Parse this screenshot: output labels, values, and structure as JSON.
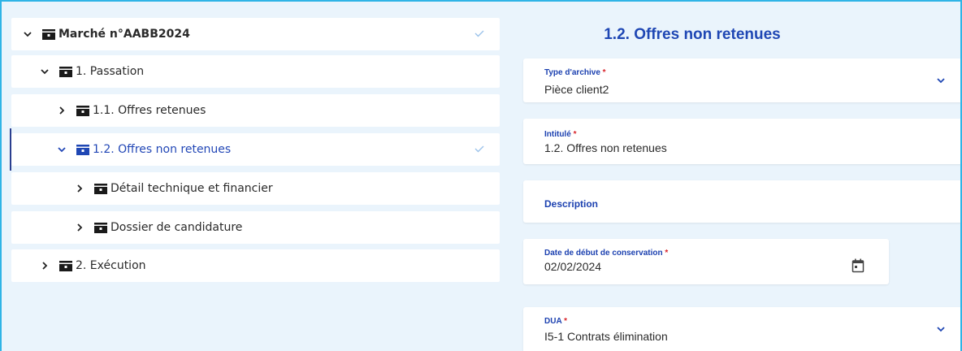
{
  "tree": {
    "items": [
      {
        "label": "Marché n°AABB2024",
        "level": "root",
        "expanded": true,
        "checked": true
      },
      {
        "label": "1. Passation",
        "level": 1,
        "expanded": true,
        "checked": false
      },
      {
        "label": "1.1. Offres retenues",
        "level": 2,
        "expanded": false,
        "checked": false
      },
      {
        "label": "1.2. Offres non retenues",
        "level": 2,
        "expanded": true,
        "checked": true,
        "selected": true
      },
      {
        "label": "Détail technique et financier",
        "level": 3,
        "expanded": false,
        "checked": false
      },
      {
        "label": "Dossier de candidature",
        "level": 3,
        "expanded": false,
        "checked": false
      },
      {
        "label": "2. Exécution",
        "level": 1,
        "expanded": false,
        "checked": false
      }
    ]
  },
  "form": {
    "title": "1.2. Offres non retenues",
    "type_archive": {
      "label": "Type d'archive",
      "required_mark": "*",
      "value": "Pièce client2"
    },
    "intitule": {
      "label": "Intitulé",
      "required_mark": "*",
      "value": "1.2. Offres non retenues"
    },
    "description": {
      "label": "Description"
    },
    "date_debut": {
      "label": "Date de début de conservation",
      "required_mark": "*",
      "value": "02/02/2024"
    },
    "dua": {
      "label": "DUA",
      "required_mark": "*",
      "value": "I5-1 Contrats élimination"
    }
  },
  "colors": {
    "accent": "#1f47b4",
    "required": "#d8232a",
    "frame_border": "#2fb4e6",
    "check": "#9bc2ea"
  },
  "icons": {
    "chevron_down": "chevron-down-icon",
    "chevron_right": "chevron-right-icon",
    "folder": "folder-icon",
    "check": "check-icon",
    "calendar": "calendar-icon"
  }
}
